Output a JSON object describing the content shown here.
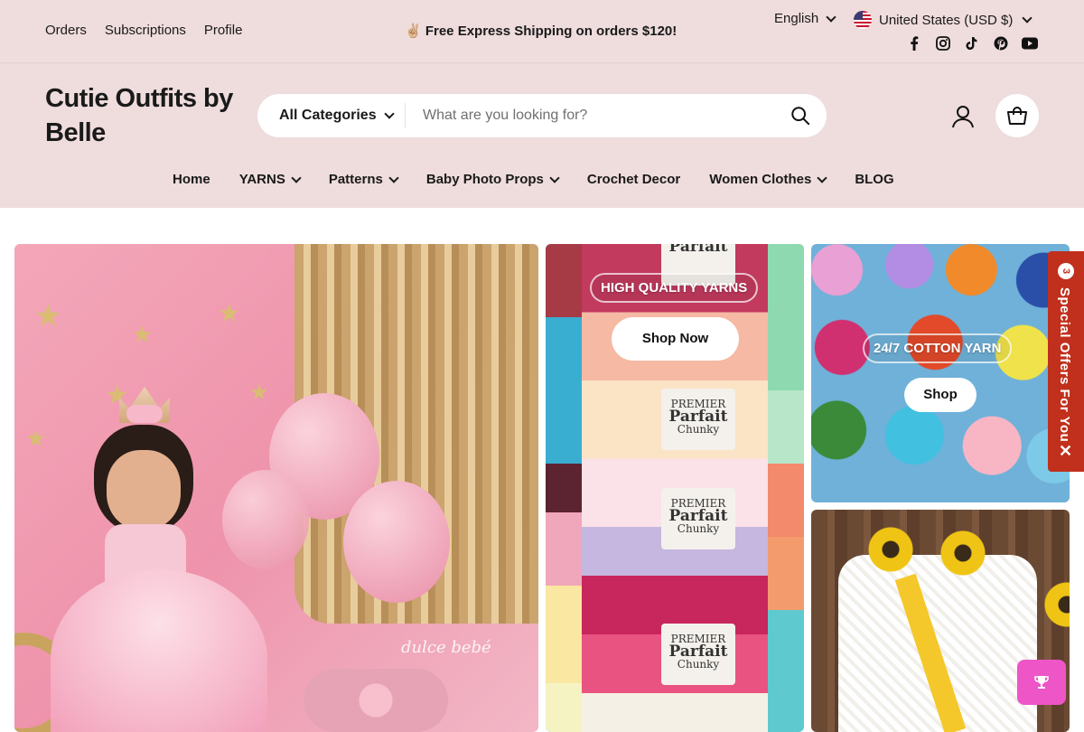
{
  "topbar": {
    "links": [
      "Orders",
      "Subscriptions",
      "Profile"
    ],
    "promo": "✌🏼 Free Express Shipping on orders $120!",
    "language": "English",
    "currency": "United States (USD $)",
    "social": [
      "facebook-icon",
      "instagram-icon",
      "tiktok-icon",
      "pinterest-icon",
      "youtube-icon"
    ]
  },
  "header": {
    "store_name": "Cutie Outfits by Belle",
    "search": {
      "category": "All Categories",
      "placeholder": "What are you looking for?"
    }
  },
  "nav": {
    "items": [
      {
        "label": "Home",
        "has_dropdown": false
      },
      {
        "label": "YARNS",
        "has_dropdown": true
      },
      {
        "label": "Patterns",
        "has_dropdown": true
      },
      {
        "label": "Baby Photo Props",
        "has_dropdown": true
      },
      {
        "label": "Crochet Decor",
        "has_dropdown": false
      },
      {
        "label": "Women Clothes",
        "has_dropdown": true
      },
      {
        "label": "BLOG",
        "has_dropdown": false
      }
    ]
  },
  "hero": {
    "left": {
      "watermark": "dulce bebé"
    },
    "middle": {
      "badge": "HIGH QUALITY YARNS",
      "button": "Shop Now",
      "yarn_labels": [
        {
          "brand": "PREMIER",
          "name": "Parfait",
          "sub": "Chunky"
        },
        {
          "brand": "PREMIER",
          "name": "Parfait",
          "sub": "Chunky"
        },
        {
          "brand": "PREMIER",
          "name": "Parfait",
          "sub": "Chunky"
        },
        {
          "brand": "PREMIER",
          "name": "Parfait",
          "sub": "Chunky"
        }
      ]
    },
    "right_top": {
      "badge": "24/7 COTTON YARN",
      "button": "Shop"
    }
  },
  "offers_tab": {
    "count": "3",
    "label": "Special Offers For You"
  },
  "colors": {
    "topbar_bg": "#efdcdc",
    "offers_red": "#c0301c",
    "rewards_pink": "#ee55c7"
  }
}
